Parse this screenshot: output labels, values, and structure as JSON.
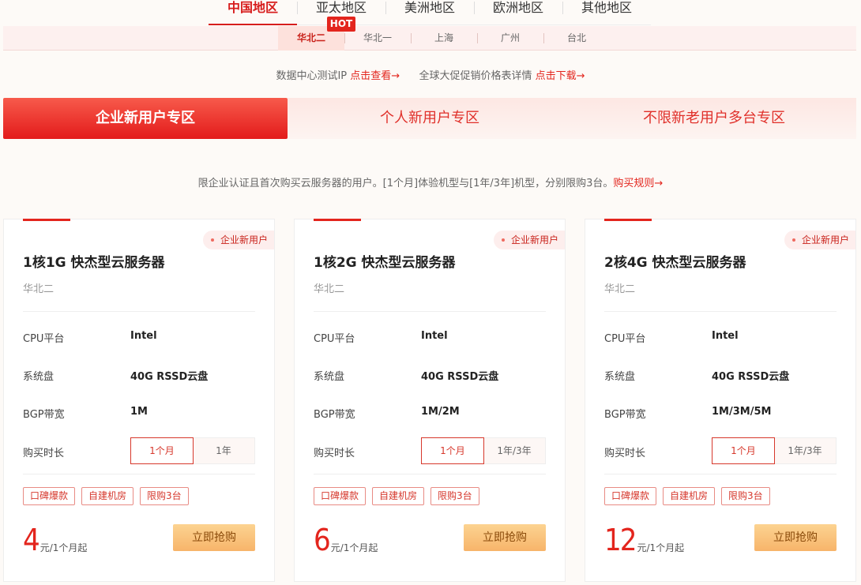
{
  "regions": [
    "中国地区",
    "亚太地区",
    "美洲地区",
    "欧洲地区",
    "其他地区"
  ],
  "cities": [
    "华北二",
    "华北一",
    "上海",
    "广州",
    "台北"
  ],
  "hot_badge": "HOT",
  "info": {
    "ip_text": "数据中心测试IP",
    "ip_link": "点击查看→",
    "price_text": "全球大促促销价格表详情",
    "price_link": "点击下载→"
  },
  "zones": [
    "企业新用户专区",
    "个人新用户专区",
    "不限新老用户多台专区"
  ],
  "notice": {
    "text": "限企业认证且首次购买云服务器的用户。[1个月]体验机型与[1年/3年]机型，分别限购3台。",
    "link": "购买规则→"
  },
  "labels": {
    "cpu": "CPU平台",
    "disk": "系统盘",
    "bandwidth": "BGP带宽",
    "duration": "购买时长",
    "buy": "立即抢购"
  },
  "chips": [
    "口碑爆款",
    "自建机房",
    "限购3台"
  ],
  "cards": [
    {
      "tag": "企业新用户",
      "title": "1核1G 快杰型云服务器",
      "region": "华北二",
      "cpu": "Intel",
      "disk": "40G RSSD云盘",
      "bandwidth": "1M",
      "durations": [
        "1个月",
        "1年"
      ],
      "price": "4",
      "price_unit": "元/1个月起"
    },
    {
      "tag": "企业新用户",
      "title": "1核2G 快杰型云服务器",
      "region": "华北二",
      "cpu": "Intel",
      "disk": "40G RSSD云盘",
      "bandwidth": "1M/2M",
      "durations": [
        "1个月",
        "1年/3年"
      ],
      "price": "6",
      "price_unit": "元/1个月起"
    },
    {
      "tag": "企业新用户",
      "title": "2核4G 快杰型云服务器",
      "region": "华北二",
      "cpu": "Intel",
      "disk": "40G RSSD云盘",
      "bandwidth": "1M/3M/5M",
      "durations": [
        "1个月",
        "1年/3年"
      ],
      "price": "12",
      "price_unit": "元/1个月起"
    }
  ],
  "colors": {
    "accent": "#e3251d",
    "buy": "#f7b46a"
  }
}
